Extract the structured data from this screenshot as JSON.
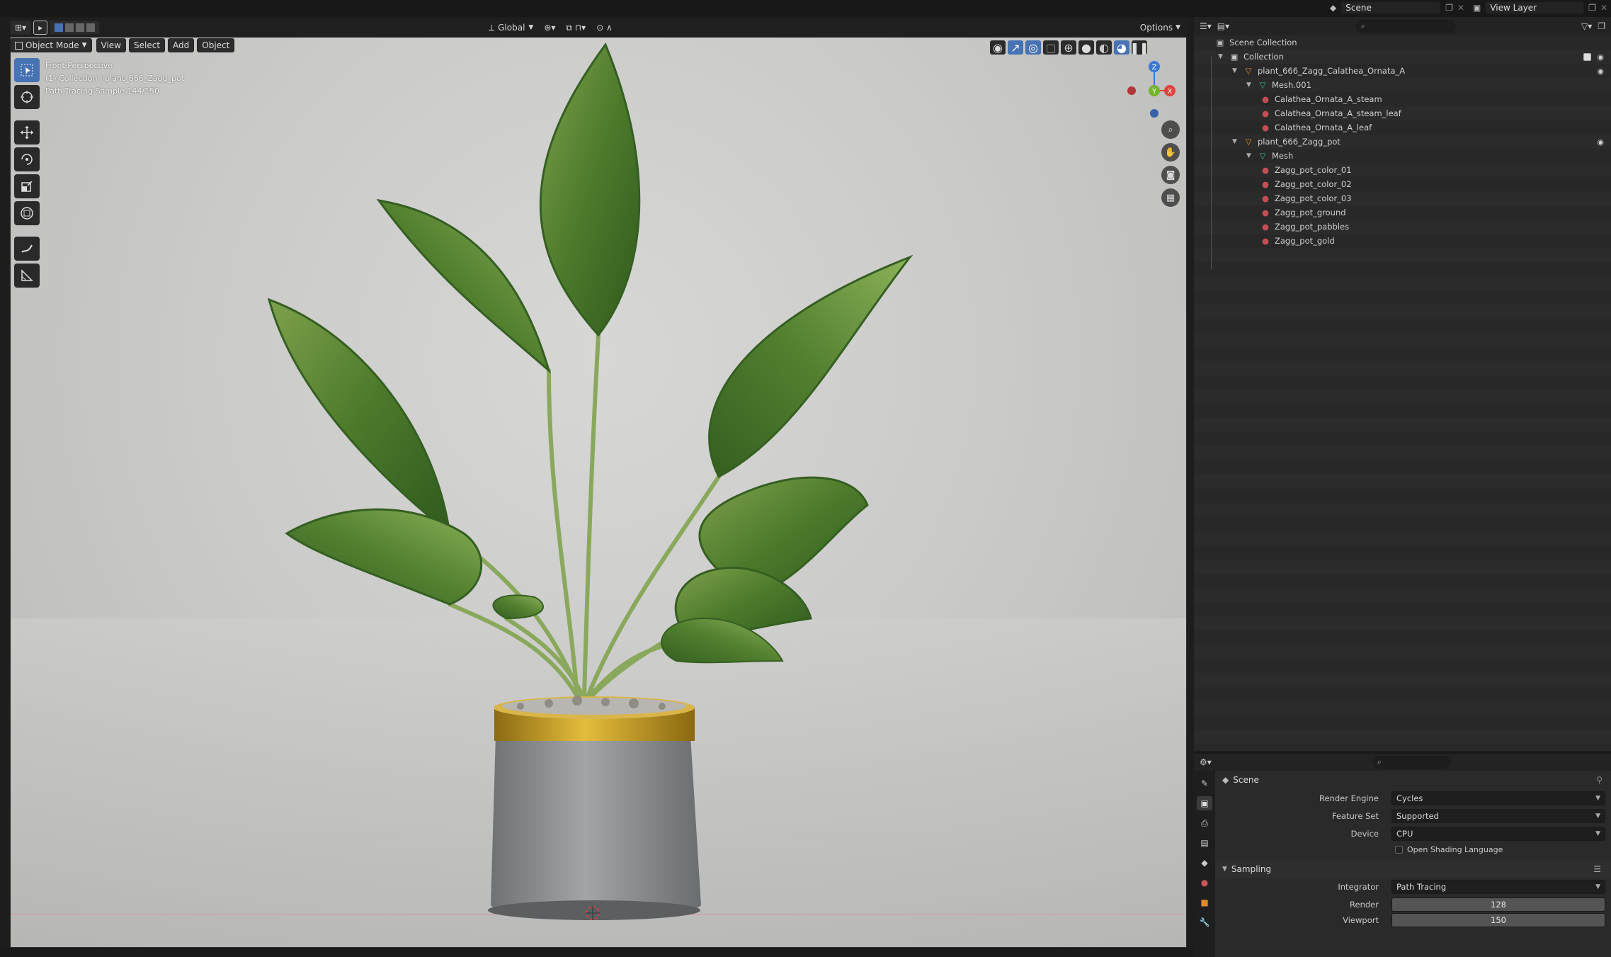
{
  "header": {
    "transform_orientation": "Global",
    "options_label": "Options",
    "scene_name": "Scene",
    "view_layer": "View Layer"
  },
  "viewport_menu": {
    "mode": "Object Mode",
    "view": "View",
    "select": "Select",
    "add": "Add",
    "object": "Object"
  },
  "viewport_overlay": {
    "line1": "Front Perspective",
    "line2": "(1) Collection | plant_666_Zagg_pot",
    "line3": "Path Tracing Sample 144/150"
  },
  "gizmo": {
    "z": "Z",
    "y": "Y",
    "x": "X"
  },
  "outliner": {
    "rows": [
      {
        "label": "Scene Collection",
        "indent": 0,
        "type": "scene"
      },
      {
        "label": "Collection",
        "indent": 1,
        "type": "collection"
      },
      {
        "label": "plant_666_Zagg_Calathea_Ornata_A",
        "indent": 2,
        "type": "object"
      },
      {
        "label": "Mesh.001",
        "indent": 3,
        "type": "mesh"
      },
      {
        "label": "Calathea_Ornata_A_steam",
        "indent": 4,
        "type": "material"
      },
      {
        "label": "Calathea_Ornata_A_steam_leaf",
        "indent": 4,
        "type": "material"
      },
      {
        "label": "Calathea_Ornata_A_leaf",
        "indent": 4,
        "type": "material"
      },
      {
        "label": "plant_666_Zagg_pot",
        "indent": 2,
        "type": "object"
      },
      {
        "label": "Mesh",
        "indent": 3,
        "type": "mesh"
      },
      {
        "label": "Zagg_pot_color_01",
        "indent": 4,
        "type": "material"
      },
      {
        "label": "Zagg_pot_color_02",
        "indent": 4,
        "type": "material"
      },
      {
        "label": "Zagg_pot_color_03",
        "indent": 4,
        "type": "material"
      },
      {
        "label": "Zagg_pot_ground",
        "indent": 4,
        "type": "material"
      },
      {
        "label": "Zagg_pot_pabbles",
        "indent": 4,
        "type": "material"
      },
      {
        "label": "Zagg_pot_gold",
        "indent": 4,
        "type": "material"
      }
    ]
  },
  "properties": {
    "title": "Scene",
    "render_engine_label": "Render Engine",
    "render_engine": "Cycles",
    "feature_set_label": "Feature Set",
    "feature_set": "Supported",
    "device_label": "Device",
    "device": "CPU",
    "osl_label": "Open Shading Language",
    "sampling_label": "Sampling",
    "integrator_label": "Integrator",
    "integrator": "Path Tracing",
    "render_label": "Render",
    "render_samples": "128",
    "viewport_label": "Viewport",
    "viewport_samples": "150"
  },
  "colors": {
    "accent": "#4772b3",
    "leaf_green": "#4f7a2e",
    "pot_gray": "#8c9093",
    "gold": "#c9a02a"
  }
}
